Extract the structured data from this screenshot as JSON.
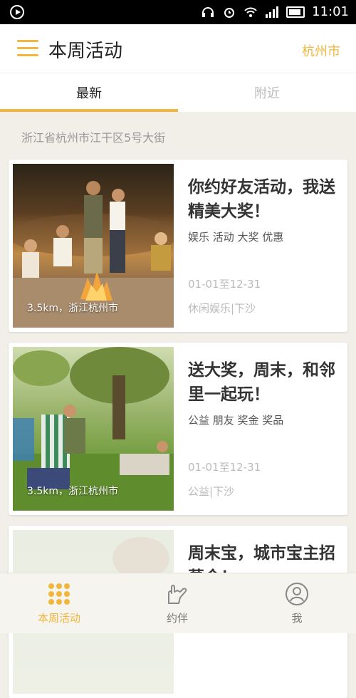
{
  "status_bar": {
    "time": "11:01"
  },
  "header": {
    "title": "本周活动",
    "city": "杭州市"
  },
  "tabs": [
    {
      "label": "最新"
    },
    {
      "label": "附近"
    }
  ],
  "location": "浙江省杭州市江干区5号大街",
  "cards": [
    {
      "title": "你约好友活动，我送精美大奖！",
      "keywords": "娱乐  活动  大奖  优惠",
      "date": "01-01至12-31",
      "category": "休闲娱乐|下沙",
      "image_tag": "3.5km，浙江杭州市"
    },
    {
      "title": "送大奖，周末，和邻里一起玩！",
      "keywords": "公益  朋友  奖金  奖品",
      "date": "01-01至12-31",
      "category": "公益|下沙",
      "image_tag": "3.5km，浙江杭州市"
    },
    {
      "title": "周末宝，城市宝主招募令！",
      "keywords": "",
      "date": "",
      "category": "",
      "image_tag": ""
    }
  ],
  "tab_bar": [
    {
      "label": "本周活动",
      "icon": "dots-grid-icon"
    },
    {
      "label": "约伴",
      "icon": "hand-icon"
    },
    {
      "label": "我",
      "icon": "user-icon"
    }
  ],
  "colors": {
    "accent": "#f2b63d"
  }
}
